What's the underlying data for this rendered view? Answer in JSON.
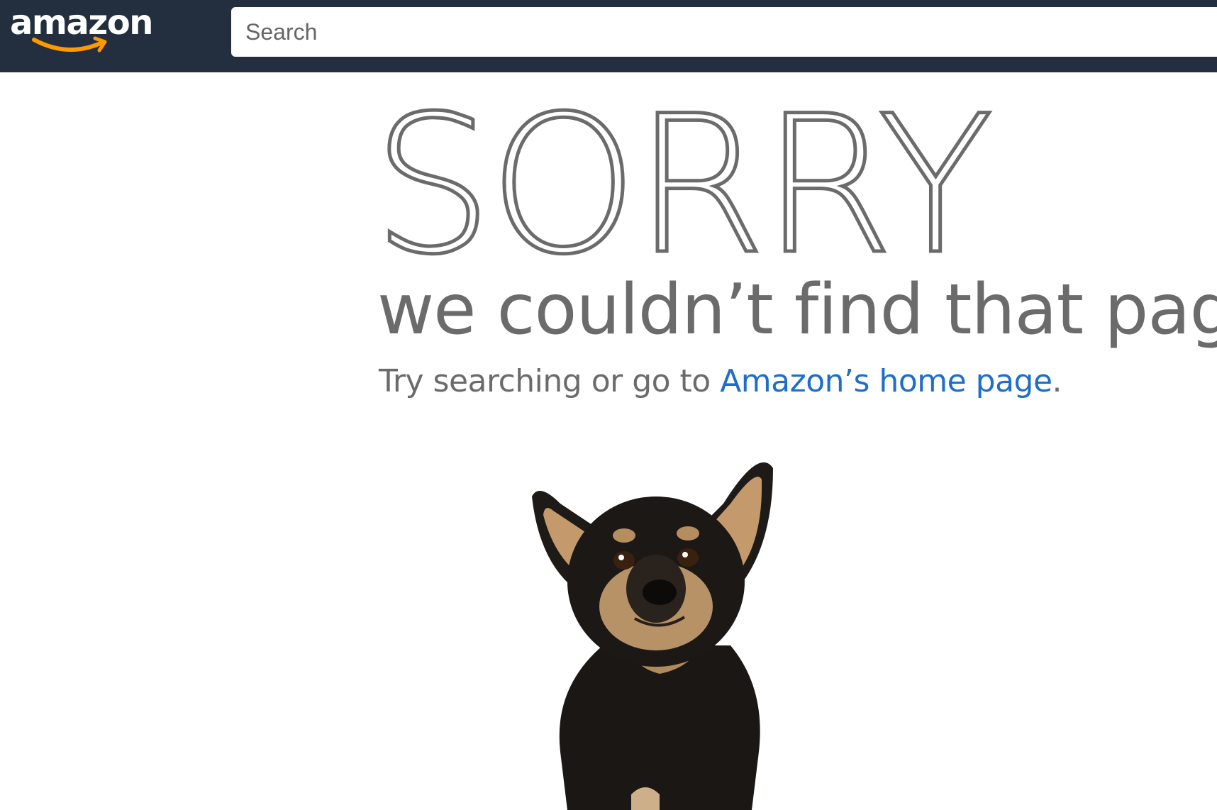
{
  "header": {
    "logo_text": "amazon",
    "search_placeholder": "Search"
  },
  "error": {
    "headline": "SORRY",
    "subtitle": "we couldn’t find that page",
    "help_prefix": "Try searching or go to ",
    "home_link": "Amazon’s home page",
    "help_suffix": "."
  },
  "colors": {
    "navbar": "#232f3e",
    "logo_smile": "#ff9900",
    "text_gray": "#6b6b6b",
    "link_blue": "#1e6ec9"
  },
  "image": {
    "subject": "dog-photo"
  }
}
